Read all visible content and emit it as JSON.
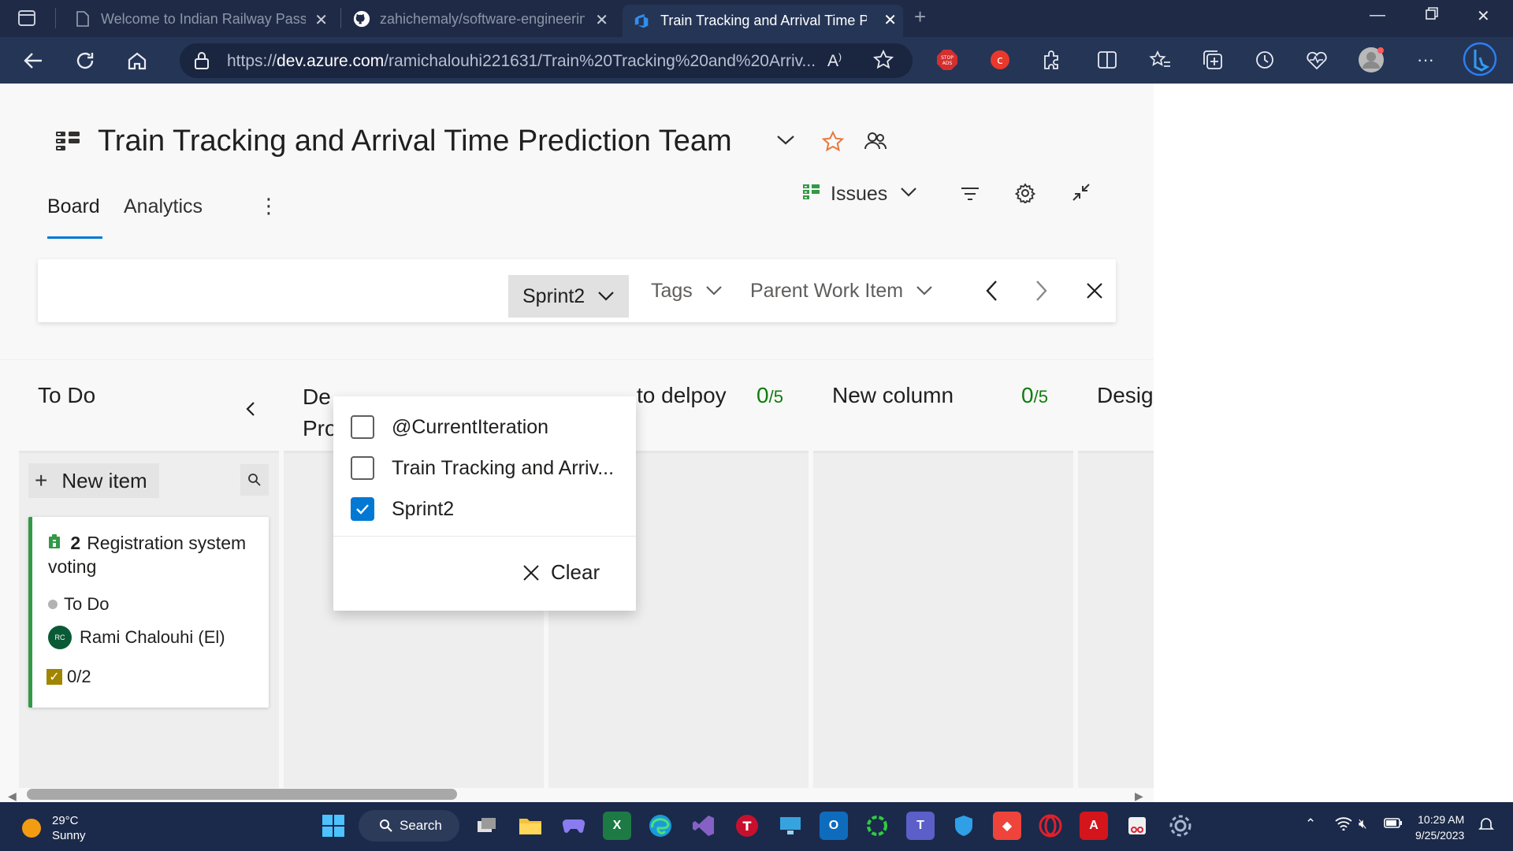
{
  "browser": {
    "tabs": [
      {
        "title": "Welcome to Indian Railway Passe",
        "icon": "document-icon"
      },
      {
        "title": "zahichemaly/software-engineerin",
        "icon": "github-icon"
      },
      {
        "title": "Train Tracking and Arrival Time Pr",
        "icon": "azure-devops-icon",
        "active": true
      }
    ],
    "url_prefix": "https://",
    "url_domain": "dev.azure.com",
    "url_path": "/ramichalouhi221631/Train%20Tracking%20and%20Arriv..."
  },
  "header": {
    "team_title": "Train Tracking and Arrival Time Prediction Team"
  },
  "pivots": {
    "board": "Board",
    "analytics": "Analytics"
  },
  "commandbar": {
    "backlog_level": "Issues"
  },
  "filterbar": {
    "sprint": "Sprint2",
    "tags": "Tags",
    "parent": "Parent Work Item"
  },
  "columns": [
    {
      "title": "To Do"
    },
    {
      "title_line1": "De",
      "title_line2": "Pro"
    },
    {
      "title": "to delpoy",
      "count": "0",
      "limit": "/5"
    },
    {
      "title": "New column",
      "count": "0",
      "limit": "/5"
    },
    {
      "title": "Desig"
    }
  ],
  "board": {
    "new_item": "New item"
  },
  "card": {
    "id": "2",
    "title": "Registration system voting",
    "state": "To Do",
    "assignee_initials": "RC",
    "assignee": "Rami Chalouhi (El)",
    "tasks": "0/2",
    "accent_color": "#339947"
  },
  "dropdown": {
    "options": [
      {
        "label": "@CurrentIteration",
        "checked": false
      },
      {
        "label": "Train Tracking and Arriv...",
        "checked": false
      },
      {
        "label": "Sprint2",
        "checked": true
      }
    ],
    "clear": "Clear"
  },
  "taskbar": {
    "temperature": "29°C",
    "condition": "Sunny",
    "search": "Search",
    "time": "10:29 AM",
    "date": "9/25/2023"
  },
  "colors": {
    "accent": "#0078d4",
    "count_green": "#107c10",
    "browser_frame": "#1f2b46"
  }
}
